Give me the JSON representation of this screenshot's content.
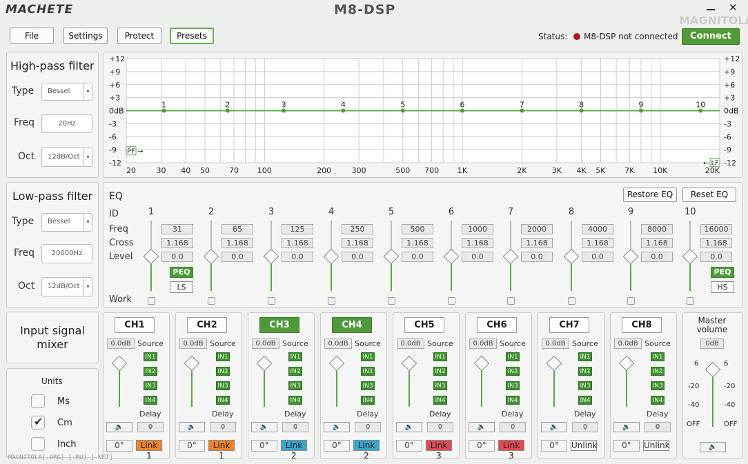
{
  "brand": "MACHETE",
  "title": "M8-DSP",
  "watermark_top": "MAGNITOLA",
  "close": "✕",
  "menu": [
    "File",
    "Settings",
    "Protect",
    "Presets"
  ],
  "status": {
    "label": "Status:",
    "text": "M8-DSP not connected",
    "dot_color": "#b01818"
  },
  "connect": "Connect",
  "hpf": {
    "title": "High-pass filter",
    "type_label": "Type",
    "type": "Bessel",
    "freq_label": "Freq",
    "freq": "20Hz",
    "oct_label": "Oct",
    "oct": "12dB/Oct"
  },
  "lpf": {
    "title": "Low-pass filter",
    "type_label": "Type",
    "type": "Bessel",
    "freq_label": "Freq",
    "freq": "20000Hz",
    "oct_label": "Oct",
    "oct": "12dB/Oct"
  },
  "graph": {
    "y_ticks": [
      "+12",
      "+9",
      "+6",
      "+3",
      "0dB",
      "-3",
      "-6",
      "-9",
      "-12"
    ],
    "x_ticks": [
      "20",
      "30",
      "40",
      "50",
      "70",
      "100",
      "200",
      "300",
      "500",
      "700",
      "1K",
      "2K",
      "3K",
      "4K",
      "5K",
      "7K",
      "10K",
      "20K"
    ],
    "points": [
      "1",
      "2",
      "3",
      "4",
      "5",
      "6",
      "7",
      "8",
      "9",
      "10"
    ],
    "hpf_tag": "PF",
    "lpf_tag": "LF"
  },
  "eq": {
    "title": "EQ",
    "restore": "Restore EQ",
    "reset": "Reset EQ",
    "row_labels": {
      "id": "ID",
      "freq": "Freq",
      "cross": "Cross",
      "level": "Level",
      "work": "Work"
    },
    "bands": [
      {
        "id": "1",
        "freq": "31",
        "cross": "1.168",
        "level": "0.0"
      },
      {
        "id": "2",
        "freq": "65",
        "cross": "1.168",
        "level": "0.0"
      },
      {
        "id": "3",
        "freq": "125",
        "cross": "1.168",
        "level": "0.0"
      },
      {
        "id": "4",
        "freq": "250",
        "cross": "1.168",
        "level": "0.0"
      },
      {
        "id": "5",
        "freq": "500",
        "cross": "1.168",
        "level": "0.0"
      },
      {
        "id": "6",
        "freq": "1000",
        "cross": "1.168",
        "level": "0.0"
      },
      {
        "id": "7",
        "freq": "2000",
        "cross": "1.168",
        "level": "0.0"
      },
      {
        "id": "8",
        "freq": "4000",
        "cross": "1.168",
        "level": "0.0"
      },
      {
        "id": "9",
        "freq": "8000",
        "cross": "1.168",
        "level": "0.0"
      },
      {
        "id": "10",
        "freq": "16000",
        "cross": "1.168",
        "level": "0.0"
      }
    ],
    "b1": {
      "peq": "PEQ",
      "alt": "LS"
    },
    "b10": {
      "peq": "PEQ",
      "alt": "HS"
    }
  },
  "mixer_title": "Input signal mixer",
  "units": {
    "title": "Units",
    "items": [
      {
        "label": "Ms",
        "checked": false
      },
      {
        "label": "Cm",
        "checked": true
      },
      {
        "label": "Inch",
        "checked": false
      }
    ]
  },
  "channels": [
    {
      "name": "CH1",
      "active": false,
      "gain": "0.0dB",
      "source": "Source",
      "ins": [
        "IN1",
        "IN2",
        "IN3",
        "IN4"
      ],
      "delay_label": "Delay",
      "delay": "0",
      "phase": "0°",
      "link": "Link 1",
      "link_color": "#f0842c"
    },
    {
      "name": "CH2",
      "active": false,
      "gain": "0.0dB",
      "source": "Source",
      "ins": [
        "IN1",
        "IN2",
        "IN3",
        "IN4"
      ],
      "delay_label": "Delay",
      "delay": "0",
      "phase": "0°",
      "link": "Link 1",
      "link_color": "#f0842c"
    },
    {
      "name": "CH3",
      "active": true,
      "gain": "0.0dB",
      "source": "Source",
      "ins": [
        "IN1",
        "IN2",
        "IN3",
        "IN4"
      ],
      "delay_label": "Delay",
      "delay": "0",
      "phase": "0°",
      "link": "Link 2",
      "link_color": "#3aa7cf"
    },
    {
      "name": "CH4",
      "active": true,
      "gain": "0.0dB",
      "source": "Source",
      "ins": [
        "IN1",
        "IN2",
        "IN3",
        "IN4"
      ],
      "delay_label": "Delay",
      "delay": "0",
      "phase": "0°",
      "link": "Link 2",
      "link_color": "#3aa7cf"
    },
    {
      "name": "CH5",
      "active": false,
      "gain": "0.0dB",
      "source": "Source",
      "ins": [
        "IN1",
        "IN2",
        "IN3",
        "IN4"
      ],
      "delay_label": "Delay",
      "delay": "0",
      "phase": "0°",
      "link": "Link 3",
      "link_color": "#e04a55"
    },
    {
      "name": "CH6",
      "active": false,
      "gain": "0.0dB",
      "source": "Source",
      "ins": [
        "IN1",
        "IN2",
        "IN3",
        "IN4"
      ],
      "delay_label": "Delay",
      "delay": "0",
      "phase": "0°",
      "link": "Link 3",
      "link_color": "#e04a55"
    },
    {
      "name": "CH7",
      "active": false,
      "gain": "0.0dB",
      "source": "Source",
      "ins": [
        "IN1",
        "IN2",
        "IN3",
        "IN4"
      ],
      "delay_label": "Delay",
      "delay": "0",
      "phase": "0°",
      "link": "Unlink",
      "link_color": "#f4f4f4"
    },
    {
      "name": "CH8",
      "active": false,
      "gain": "0.0dB",
      "source": "Source",
      "ins": [
        "IN1",
        "IN2",
        "IN3",
        "IN4"
      ],
      "delay_label": "Delay",
      "delay": "0",
      "phase": "0°",
      "link": "Unlink",
      "link_color": "#f4f4f4"
    }
  ],
  "master": {
    "title": "Master volume",
    "gain": "0dB",
    "scale": [
      "6",
      "-20",
      "-40",
      "OFF"
    ]
  },
  "footer_watermark": "MAGNITOLA[.ORG] [.RU] [.NET]"
}
